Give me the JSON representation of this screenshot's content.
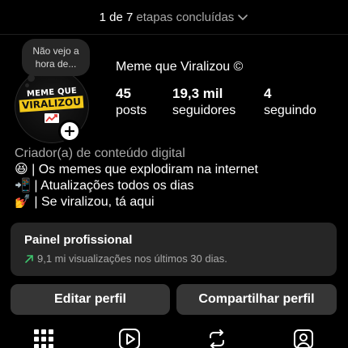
{
  "progress": {
    "count": "1 de 7",
    "label": "etapas concluídas"
  },
  "note": {
    "line1": "Não vejo a",
    "line2": "hora de..."
  },
  "avatar": {
    "logo_line1": "MEME QUE",
    "logo_line2": "VIRALIZOU"
  },
  "profile": {
    "name": "Meme que Viralizou ©"
  },
  "stats": [
    {
      "value": "45",
      "label": "posts"
    },
    {
      "value": "19,3 mil",
      "label": "seguidores"
    },
    {
      "value": "4",
      "label": "seguindo"
    }
  ],
  "bio": {
    "category": "Criador(a) de conteúdo digital",
    "lines": [
      "😆 | Os memes que explodiram na internet",
      "📲 | Atualizações todos os dias",
      "💅 | Se viralizou, tá aqui"
    ]
  },
  "professional_panel": {
    "title": "Painel profissional",
    "subtitle": "9,1 mi visualizações nos últimos 30 dias."
  },
  "buttons": {
    "edit": "Editar perfil",
    "share": "Compartilhar perfil"
  },
  "tabs": [
    {
      "icon": "grid-icon"
    },
    {
      "icon": "reels-icon"
    },
    {
      "icon": "reposts-icon"
    },
    {
      "icon": "tagged-icon"
    }
  ],
  "colors": {
    "background": "#000000",
    "panel": "#262626",
    "button": "#363636",
    "secondary_text": "#a8a8a8",
    "trend_green": "#3ec46d",
    "logo_yellow": "#f2c81a"
  }
}
